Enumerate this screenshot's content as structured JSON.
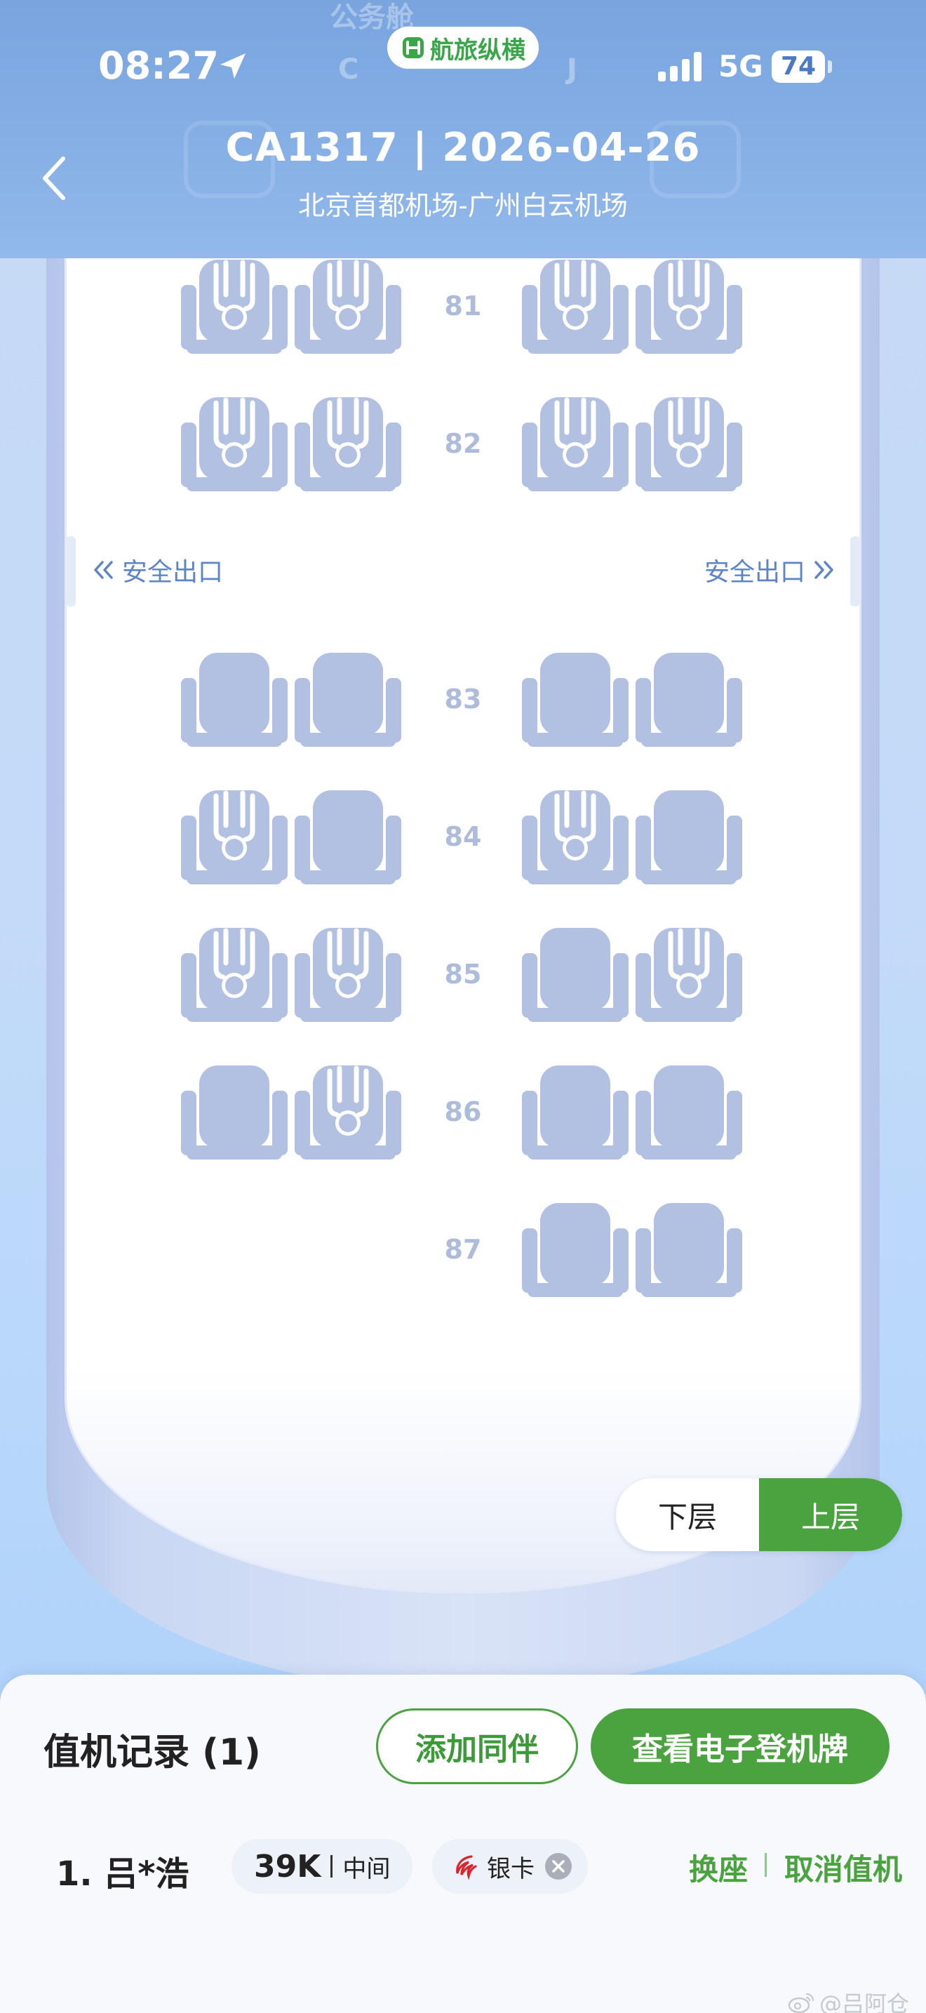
{
  "status_bar": {
    "time": "08:27",
    "network": "5G",
    "battery": "74"
  },
  "app_badge": {
    "label": "航旅纵横"
  },
  "header": {
    "flight_title": "CA1317 | 2026-04-26",
    "route": "北京首都机场-广州白云机场",
    "ghost_cabin_name": "公务舱",
    "ghost_col_left": "C",
    "ghost_col_right": "J"
  },
  "colors": {
    "header_bg": "#87b0e6",
    "seat_fill": "#b2c1e2",
    "accent_green": "#4aa33f",
    "exit_text": "#5d84c6"
  },
  "seat_map": {
    "rows": [
      {
        "number": "81",
        "seats": [
          "occupied",
          "occupied",
          "occupied",
          "occupied"
        ]
      },
      {
        "number": "82",
        "seats": [
          "occupied",
          "occupied",
          "occupied",
          "occupied"
        ]
      },
      {
        "number": "83",
        "seats": [
          "available",
          "available",
          "available",
          "available"
        ]
      },
      {
        "number": "84",
        "seats": [
          "occupied",
          "available",
          "occupied",
          "available"
        ]
      },
      {
        "number": "85",
        "seats": [
          "occupied",
          "occupied",
          "available",
          "occupied"
        ]
      },
      {
        "number": "86",
        "seats": [
          "available",
          "occupied",
          "available",
          "available"
        ]
      },
      {
        "number": "87",
        "seats": [
          "none",
          "none",
          "available",
          "available"
        ]
      }
    ],
    "exit_left": "安全出口",
    "exit_right": "安全出口"
  },
  "deck_toggle": {
    "lower": "下层",
    "upper": "上层",
    "selected": "upper"
  },
  "checkin_panel": {
    "title": "值机记录 (1)",
    "add_companion": "添加同伴",
    "view_boarding_pass": "查看电子登机牌",
    "passenger": {
      "name": "1. 吕*浩",
      "seat": "39K",
      "seat_position": "中间",
      "tier": "银卡",
      "change_seat": "换座",
      "cancel_checkin": "取消值机"
    }
  },
  "watermark": "@吕阿仓",
  "icons": {
    "back": "chevron-left-icon",
    "location": "location-arrow-icon",
    "signal": "signal-bars-icon",
    "app": "app-logo-icon",
    "exit_left": "double-chevron-left-icon",
    "exit_right": "double-chevron-right-icon",
    "airline": "air-china-logo-icon",
    "clear": "clear-circle-icon",
    "weibo": "weibo-icon"
  }
}
